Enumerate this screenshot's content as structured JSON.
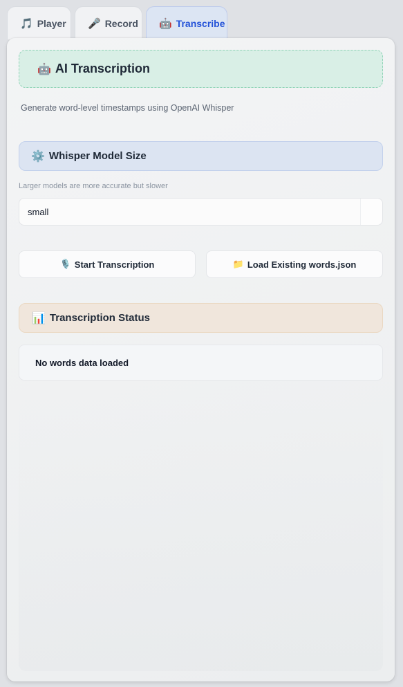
{
  "tabs": [
    {
      "icon": "🎵",
      "icon_name": "music-note-icon",
      "label": "Player",
      "active": false
    },
    {
      "icon": "🎤",
      "icon_name": "microphone-icon",
      "label": "Record",
      "active": false
    },
    {
      "icon": "🤖",
      "icon_name": "robot-icon",
      "label": "Transcribe",
      "active": true
    }
  ],
  "header": {
    "icon": "🤖",
    "icon_name": "robot-icon",
    "title": "AI Transcription"
  },
  "subtitle": "Generate word-level timestamps using OpenAI Whisper",
  "model": {
    "icon": "⚙️",
    "icon_name": "gear-icon",
    "title": "Whisper Model Size",
    "hint": "Larger models are more accurate but slower",
    "selected": "small"
  },
  "actions": {
    "start": {
      "icon": "🎙️",
      "icon_name": "studio-microphone-icon",
      "label": "Start Transcription"
    },
    "load": {
      "icon": "📁",
      "icon_name": "folder-icon",
      "label": "Load Existing words.json"
    }
  },
  "status": {
    "icon": "📊",
    "icon_name": "bar-chart-icon",
    "title": "Transcription Status",
    "message": "No words data loaded"
  },
  "colors": {
    "active_tab_text": "#2553d8",
    "header_bg": "#d9efe6",
    "model_header_bg": "#dce4f2",
    "status_header_bg": "#f0e6dc"
  }
}
